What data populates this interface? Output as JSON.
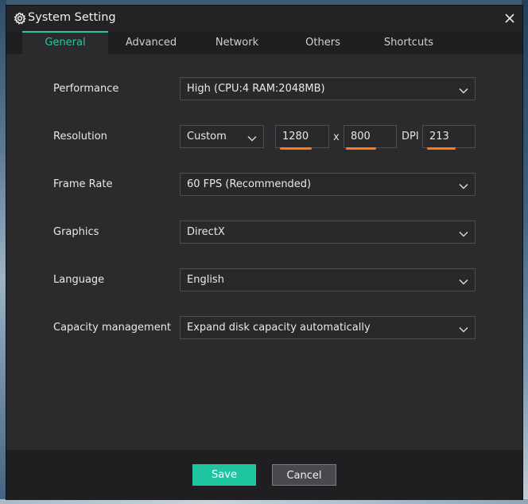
{
  "window": {
    "title": "System Setting",
    "title_icon": "gear-icon",
    "close_icon": "close-icon"
  },
  "tabs": [
    {
      "label": "General",
      "active": true
    },
    {
      "label": "Advanced",
      "active": false
    },
    {
      "label": "Network",
      "active": false
    },
    {
      "label": "Others",
      "active": false
    },
    {
      "label": "Shortcuts",
      "active": false
    }
  ],
  "settings": {
    "performance": {
      "label": "Performance",
      "value": "High (CPU:4 RAM:2048MB)"
    },
    "resolution": {
      "label": "Resolution",
      "mode": "Custom",
      "width": "1280",
      "separator": "x",
      "height": "800",
      "dpi_label": "DPI",
      "dpi": "213"
    },
    "frame_rate": {
      "label": "Frame Rate",
      "value": "60 FPS (Recommended)"
    },
    "graphics": {
      "label": "Graphics",
      "value": "DirectX"
    },
    "language": {
      "label": "Language",
      "value": "English"
    },
    "capacity": {
      "label": "Capacity management",
      "value": "Expand disk capacity automatically"
    }
  },
  "footer": {
    "save_label": "Save",
    "cancel_label": "Cancel"
  },
  "colors": {
    "accent": "#1fc4a0",
    "highlight_underline": "#ff7a1a",
    "panel": "#2b2b2e",
    "bar": "#1f1f21"
  }
}
